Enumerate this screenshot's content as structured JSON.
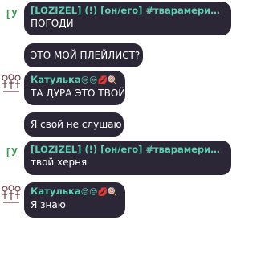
{
  "messages": [
    {
      "author": "[LOZIZEL] (!) [он/его] #тварамериканская...",
      "text": "ПОГОДИ"
    },
    {
      "text": "ЭТО МОЙ ПЛЕЙЛИСТ?"
    },
    {
      "author": "Катулька",
      "author_emoji": "😒😒💋🍭",
      "text": "ТА ДУРА ЭТО ТВОЙ"
    },
    {
      "text": "Я свой не слушаю"
    },
    {
      "author": "[LOZIZEL] (!) [он/его] #тварамериканская...",
      "text": "твой херня"
    },
    {
      "author": "Катулька",
      "author_emoji": "😒😒💋🍭",
      "text": "Я знаю"
    }
  ],
  "avatars": {
    "lozizel": "[У",
    "katulka": "silhouette-avatar"
  },
  "colors": {
    "bubble": "#2b2736",
    "name": "#5fd0b3",
    "text": "#ffffff",
    "avatar_letter": "#3a9a52"
  }
}
